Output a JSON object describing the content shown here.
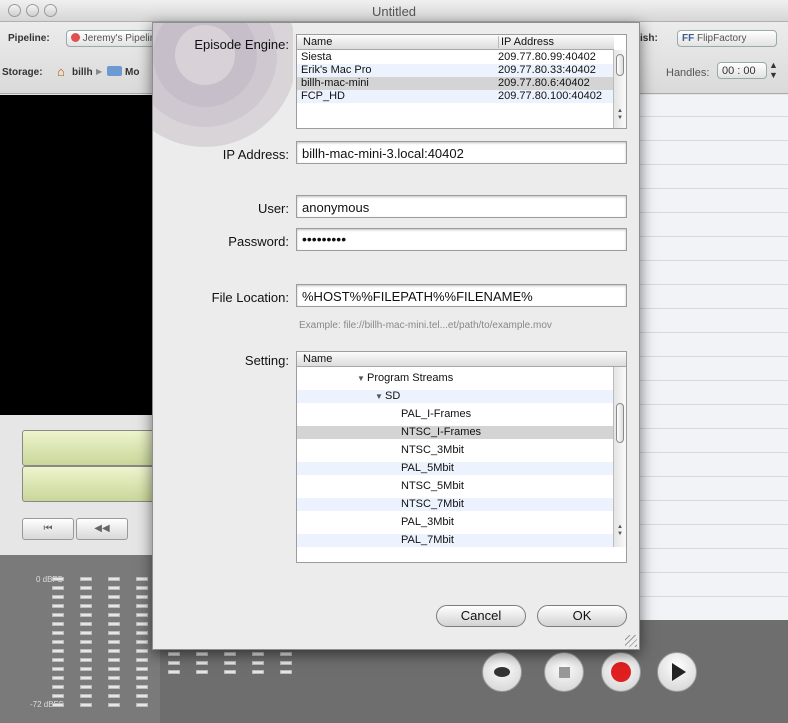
{
  "window": {
    "title": "Untitled"
  },
  "toolbar": {
    "pipeline_label": "Pipeline:",
    "pipeline_value": "Jeremy's Pipeline",
    "storage_label": "Storage:",
    "storage_crumb_1": "billh",
    "storage_crumb_2": "Mo",
    "finish_label": "ish:",
    "finish_value": "FlipFactory",
    "handles_label": "Handles:",
    "handles_value": "00 : 00"
  },
  "meters": {
    "top_label": "0 dBFS",
    "bottom_label": "-72 dBFS"
  },
  "sheet": {
    "episode_engine_label": "Episode Engine:",
    "engine_columns": [
      "Name",
      "IP Address"
    ],
    "engines": [
      {
        "name": "Siesta",
        "ip": "209.77.80.99:40402"
      },
      {
        "name": "Erik's Mac Pro",
        "ip": "209.77.80.33:40402"
      },
      {
        "name": "billh-mac-mini",
        "ip": "209.77.80.6:40402"
      },
      {
        "name": "FCP_HD",
        "ip": "209.77.80.100:40402"
      }
    ],
    "ip_address_label": "IP Address:",
    "ip_address_value": "billh-mac-mini-3.local:40402",
    "user_label": "User:",
    "user_value": "anonymous",
    "password_label": "Password:",
    "password_value": "•••••••••",
    "file_location_label": "File Location:",
    "file_location_value": "%HOST%%FILEPATH%%FILENAME%",
    "example_text": "Example:   file://billh-mac-mini.tel...et/path/to/example.mov",
    "setting_label": "Setting:",
    "setting_column": "Name",
    "settings": [
      {
        "label": "Program Streams",
        "disclosure": "▼"
      },
      {
        "label": "SD",
        "disclosure": "▼"
      },
      {
        "label": "PAL_I-Frames"
      },
      {
        "label": "NTSC_I-Frames"
      },
      {
        "label": "NTSC_3Mbit"
      },
      {
        "label": "PAL_5Mbit"
      },
      {
        "label": "NTSC_5Mbit"
      },
      {
        "label": "NTSC_7Mbit"
      },
      {
        "label": "PAL_3Mbit"
      },
      {
        "label": "PAL_7Mbit"
      }
    ],
    "cancel_label": "Cancel",
    "ok_label": "OK"
  },
  "colors": {
    "record_red": "#e02020",
    "selection_gray": "#d4d4d4",
    "alt_row_blue": "#edf3fe"
  }
}
